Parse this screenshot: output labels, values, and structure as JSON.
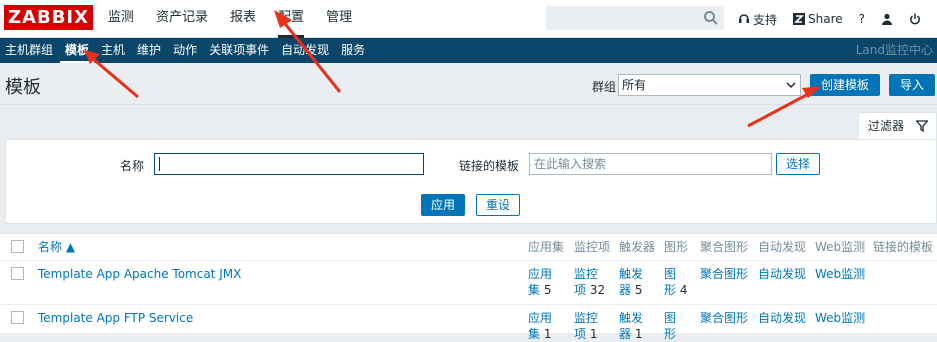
{
  "logo": "ZABBIX",
  "main_menu": [
    {
      "label": "监测"
    },
    {
      "label": "资产记录"
    },
    {
      "label": "报表"
    },
    {
      "label": "配置"
    },
    {
      "label": "管理"
    }
  ],
  "top_links": {
    "support": "支持",
    "share": "Share",
    "help": "?"
  },
  "sub_menu": [
    {
      "label": "主机群组"
    },
    {
      "label": "模板"
    },
    {
      "label": "主机"
    },
    {
      "label": "维护"
    },
    {
      "label": "动作"
    },
    {
      "label": "关联项事件"
    },
    {
      "label": "自动发现"
    },
    {
      "label": "服务"
    }
  ],
  "sub_right": "Land监控中心",
  "page": {
    "title": "模板",
    "group_label": "群组",
    "group_value": "所有",
    "create_button": "创建模板",
    "import_button": "导入"
  },
  "filter": {
    "tab_label": "过滤器",
    "name_label": "名称",
    "name_value": "",
    "linked_label": "链接的模板",
    "linked_placeholder": "在此输入搜索",
    "select_button": "选择",
    "apply_button": "应用",
    "reset_button": "重设"
  },
  "table": {
    "headers": {
      "name": "名称 ▲",
      "apps": "应用集",
      "items": "监控项",
      "triggers": "触发器",
      "graphs": "图形",
      "screens": "聚合图形",
      "discovery": "自动发现",
      "web": "Web监测",
      "linked": "链接的模板"
    },
    "rows": [
      {
        "name": "Template App Apache Tomcat JMX",
        "apps_a": "应用",
        "apps_b": "集",
        "apps_count": "5",
        "items_a": "监控",
        "items_b": "项",
        "items_count": "32",
        "triggers_a": "触发",
        "triggers_b": "器",
        "triggers_count": "5",
        "graphs_a": "图",
        "graphs_b": "形",
        "graphs_count": "4",
        "screens": "聚合图形",
        "discovery": "自动发现",
        "web": "Web监测"
      },
      {
        "name": "Template App FTP Service",
        "apps_a": "应用",
        "apps_b": "集",
        "apps_count": "1",
        "items_a": "监控",
        "items_b": "项",
        "items_count": "1",
        "triggers_a": "触发",
        "triggers_b": "器",
        "triggers_count": "1",
        "graphs_a": "图",
        "graphs_b": "形",
        "graphs_count": "",
        "screens": "聚合图形",
        "discovery": "自动发现",
        "web": "Web监测"
      }
    ]
  },
  "colors": {
    "brand": "#d40000",
    "nav_bg": "#0a466a",
    "primary": "#0275b8",
    "annotation_arrow": "#e8301c"
  }
}
